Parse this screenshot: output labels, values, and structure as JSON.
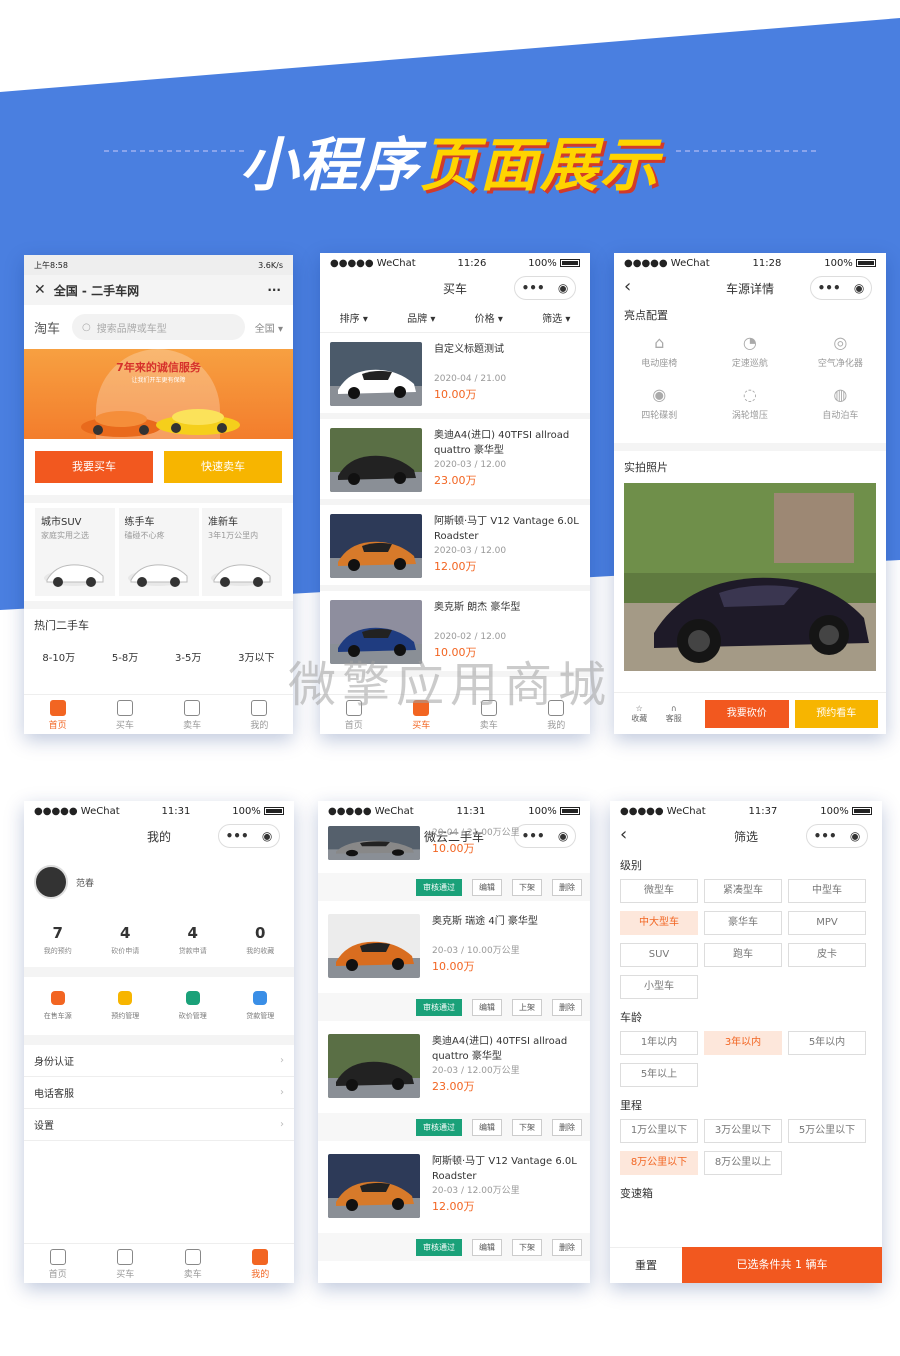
{
  "banner": {
    "title_white": "小程序",
    "title_yellow": "页面展示",
    "watermark": "微擎应用商城"
  },
  "colors": {
    "blue": "#4a7fe0",
    "orange": "#f26522",
    "yellow": "#f7b500",
    "green": "#1aa179"
  },
  "p1": {
    "status_time": "上午8:58",
    "status_right": "3.6K/s",
    "nav_title": "全国 - 二手车网",
    "brand": "淘车",
    "search_placeholder": "搜索品牌或车型",
    "region": "全国",
    "banner_text": "7年来的诚信服务",
    "banner_sub": "让我们开车更有保障",
    "buy_btn": "我要买车",
    "sell_btn": "快速卖车",
    "cats": [
      {
        "t": "城市SUV",
        "s": "家庭实用之选"
      },
      {
        "t": "练手车",
        "s": "磕碰不心疼"
      },
      {
        "t": "准新车",
        "s": "3年1万公里内"
      }
    ],
    "hot_title": "热门二手车",
    "prices": [
      "8-10万",
      "5-8万",
      "3-5万",
      "3万以下"
    ],
    "tabs": [
      "首页",
      "买车",
      "卖车",
      "我的"
    ]
  },
  "p2": {
    "status": {
      "carrier": "●●●●● WeChat",
      "time": "11:26",
      "battery": "100%"
    },
    "nav_title": "买车",
    "filters": [
      "排序",
      "品牌",
      "价格",
      "筛选"
    ],
    "items": [
      {
        "title": "自定义标题测试",
        "meta": "2020-04 / 21.00",
        "price": "10.00万"
      },
      {
        "title": "奥迪A4(进口) 40TFSI allroad quattro 豪华型",
        "meta": "2020-03 / 12.00",
        "price": "23.00万"
      },
      {
        "title": "阿斯顿·马丁 V12 Vantage 6.0L Roadster",
        "meta": "2020-03 / 12.00",
        "price": "12.00万"
      },
      {
        "title": "奥克斯 朗杰 豪华型",
        "meta": "2020-02 / 12.00",
        "price": "10.00万"
      }
    ],
    "tabs": [
      "首页",
      "买车",
      "卖车",
      "我的"
    ]
  },
  "p3": {
    "status": {
      "carrier": "●●●●● WeChat",
      "time": "11:28",
      "battery": "100%"
    },
    "nav_title": "车源详情",
    "highlight_title": "亮点配置",
    "features": [
      "电动座椅",
      "定速巡航",
      "空气净化器",
      "四轮碟刹",
      "涡轮增压",
      "自动泊车"
    ],
    "photo_title": "实拍照片",
    "fav": "收藏",
    "service": "客服",
    "bargain_btn": "我要砍价",
    "book_btn": "预约看车"
  },
  "p4": {
    "status": {
      "carrier": "●●●●● WeChat",
      "time": "11:31",
      "battery": "100%"
    },
    "nav_title": "我的",
    "username": "范春",
    "stats": [
      {
        "n": "7",
        "l": "我的预约"
      },
      {
        "n": "4",
        "l": "砍价申请"
      },
      {
        "n": "4",
        "l": "贷款申请"
      },
      {
        "n": "0",
        "l": "我的收藏"
      }
    ],
    "tools": [
      "在售车源",
      "预约管理",
      "砍价管理",
      "贷款管理"
    ],
    "menu": [
      "身份认证",
      "电话客服",
      "设置"
    ],
    "tabs": [
      "首页",
      "买车",
      "卖车",
      "我的"
    ]
  },
  "p5": {
    "status": {
      "carrier": "●●●●● WeChat",
      "time": "11:31",
      "battery": "100%"
    },
    "nav_title": "微云二手车",
    "items": [
      {
        "title": "",
        "meta": "20-04 / 21.00万公里",
        "price": "10.00万",
        "ops": [
          "审核通过",
          "编辑",
          "下架",
          "删除"
        ]
      },
      {
        "title": "奥克斯 瑞途 4门 豪华型",
        "meta": "20-03 / 10.00万公里",
        "price": "10.00万",
        "ops": [
          "审核通过",
          "编辑",
          "上架",
          "删除"
        ]
      },
      {
        "title": "奥迪A4(进口) 40TFSI allroad quattro 豪华型",
        "meta": "20-03 / 12.00万公里",
        "price": "23.00万",
        "ops": [
          "审核通过",
          "编辑",
          "下架",
          "删除"
        ]
      },
      {
        "title": "阿斯顿·马丁 V12 Vantage 6.0L Roadster",
        "meta": "20-03 / 12.00万公里",
        "price": "12.00万",
        "ops": [
          "审核通过",
          "编辑",
          "下架",
          "删除"
        ]
      }
    ]
  },
  "p6": {
    "status": {
      "carrier": "●●●●● WeChat",
      "time": "11:37",
      "battery": "100%"
    },
    "nav_title": "筛选",
    "level_title": "级别",
    "levels": [
      "微型车",
      "紧凑型车",
      "中型车",
      "中大型车",
      "豪华车",
      "MPV",
      "SUV",
      "跑车",
      "皮卡",
      "小型车"
    ],
    "age_title": "车龄",
    "ages": [
      "1年以内",
      "3年以内",
      "5年以内",
      "5年以上"
    ],
    "mile_title": "里程",
    "miles": [
      "1万公里以下",
      "3万公里以下",
      "5万公里以下",
      "8万公里以下",
      "8万公里以上"
    ],
    "gear_title": "变速箱",
    "reset_btn": "重置",
    "confirm_btn": "已选条件共 1 辆车"
  }
}
